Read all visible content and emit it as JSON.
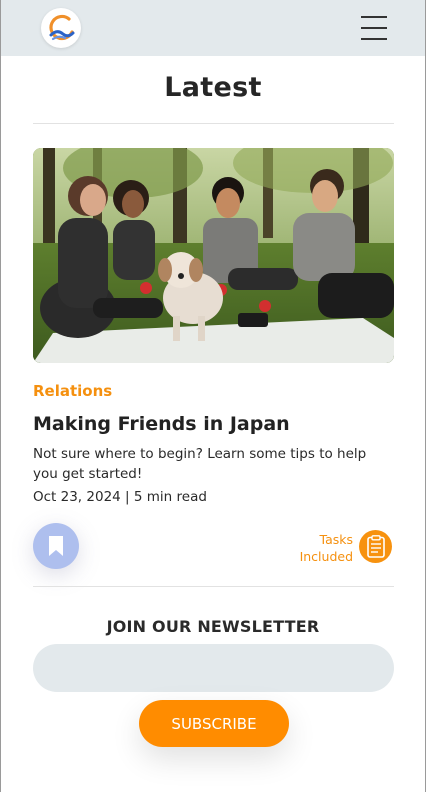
{
  "header": {
    "logo_icon": "brand-logo-icon",
    "menu_icon": "hamburger-menu-icon"
  },
  "page": {
    "title": "Latest"
  },
  "article": {
    "category": "Relations",
    "title": "Making Friends in Japan",
    "description": "Not sure where to begin? Learn some tips to help you get started!",
    "meta": "Oct 23, 2024 | 5 min read",
    "bookmark_icon": "bookmark-icon",
    "tasks_label": "Tasks Included",
    "tasks_icon": "clipboard-icon"
  },
  "newsletter": {
    "heading": "JOIN OUR NEWSLETTER",
    "input_value": "",
    "subscribe_label": "SUBSCRIBE"
  },
  "colors": {
    "accent": "#ff8c00",
    "category_text": "#f5900f",
    "header_bg": "#e3e9ec",
    "bookmark_bg": "#aebfee"
  }
}
